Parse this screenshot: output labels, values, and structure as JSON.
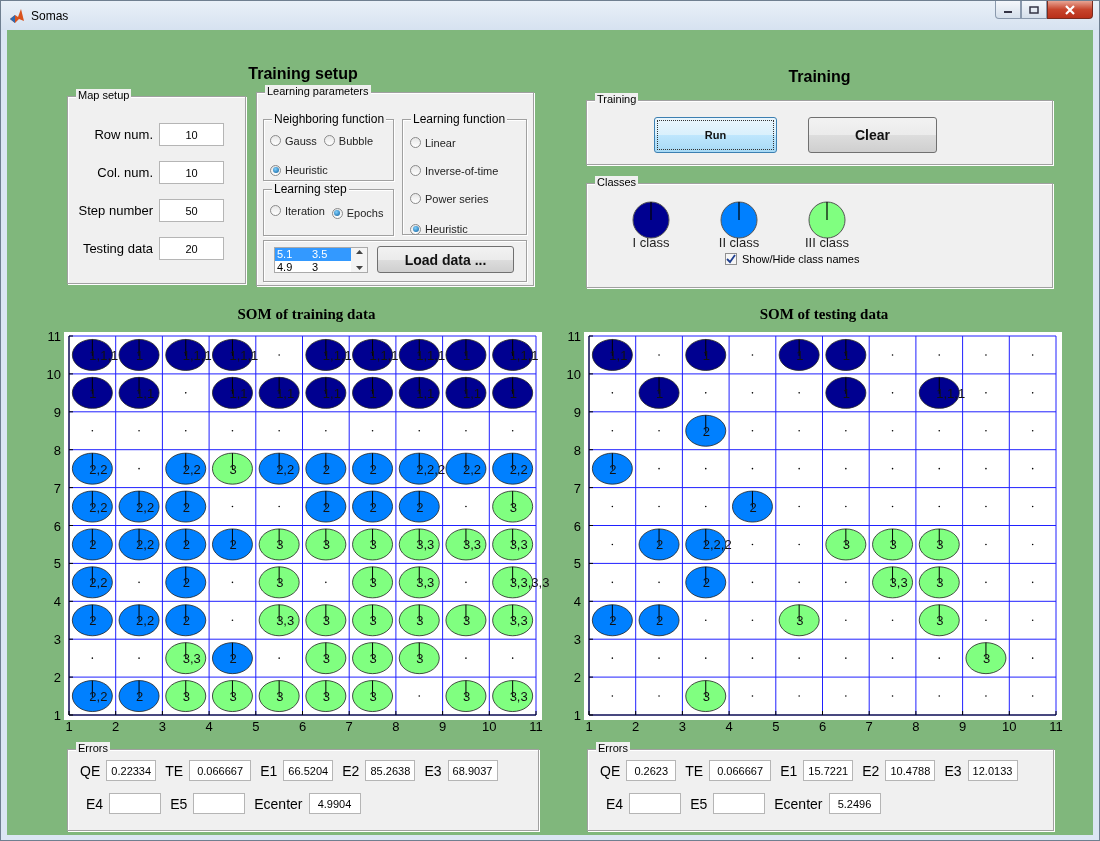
{
  "window": {
    "title": "Somas"
  },
  "training_setup": {
    "heading": "Training setup",
    "map_setup": {
      "title": "Map setup",
      "fields": [
        {
          "label": "Row num.",
          "value": "10"
        },
        {
          "label": "Col. num.",
          "value": "10"
        },
        {
          "label": "Step number",
          "value": "50"
        },
        {
          "label": "Testing data",
          "value": "20"
        }
      ]
    },
    "learning_parameters": {
      "title": "Learning parameters",
      "neighboring_function": {
        "title": "Neighboring function",
        "options": [
          {
            "label": "Gauss",
            "selected": false
          },
          {
            "label": "Bubble",
            "selected": false
          },
          {
            "label": "Heuristic",
            "selected": true
          }
        ]
      },
      "learning_step": {
        "title": "Learning step",
        "options": [
          {
            "label": "Iteration",
            "selected": false
          },
          {
            "label": "Epochs",
            "selected": true
          }
        ]
      },
      "learning_function": {
        "title": "Learning function",
        "options": [
          {
            "label": "Linear",
            "selected": false
          },
          {
            "label": "Inverse-of-time",
            "selected": false
          },
          {
            "label": "Power series",
            "selected": false
          },
          {
            "label": "Heuristic",
            "selected": true
          }
        ]
      },
      "data_list": {
        "rows": [
          {
            "col_1": "5.1",
            "col_2": "3.5",
            "selected": true
          },
          {
            "col_1": "4.9",
            "col_2": "3",
            "selected": false
          }
        ]
      },
      "load_button": "Load data ..."
    }
  },
  "training": {
    "heading": "Training",
    "panel_title": "Training",
    "buttons": [
      {
        "label": "Run",
        "focused": true
      },
      {
        "label": "Clear",
        "focused": false
      }
    ]
  },
  "classes": {
    "title": "Classes",
    "items": [
      {
        "name": "I class",
        "color": "#000090"
      },
      {
        "name": "II class",
        "color": "#0080ff"
      },
      {
        "name": "III class",
        "color": "#80ff80"
      }
    ],
    "show_names": {
      "label": "Show/Hide class names",
      "checked": true
    }
  },
  "maps": [
    {
      "title": "SOM of training data",
      "x_ticks": [
        "1",
        "2",
        "3",
        "4",
        "5",
        "6",
        "7",
        "8",
        "9",
        "10",
        "11"
      ],
      "y_ticks": [
        "11",
        "10",
        "9",
        "8",
        "7",
        "6",
        "5",
        "4",
        "3",
        "2",
        "1"
      ],
      "rows": [
        {
          "cells": [
            {
              "kind": "node",
              "label": "1,1,1",
              "color": "#000090"
            },
            {
              "kind": "node",
              "label": "1",
              "color": "#000090"
            },
            {
              "kind": "node",
              "label": "1,1,1",
              "color": "#000090"
            },
            {
              "kind": "node",
              "label": "1,1,1",
              "color": "#000090"
            },
            {
              "kind": "empty"
            },
            {
              "kind": "node",
              "label": "1,1,1",
              "color": "#000090"
            },
            {
              "kind": "node",
              "label": "1,1,1",
              "color": "#000090"
            },
            {
              "kind": "node",
              "label": "1,1,1",
              "color": "#000090"
            },
            {
              "kind": "node",
              "label": "1",
              "color": "#000090"
            },
            {
              "kind": "node",
              "label": "1,1,1",
              "color": "#000090"
            }
          ]
        },
        {
          "cells": [
            {
              "kind": "node",
              "label": "1",
              "color": "#000090"
            },
            {
              "kind": "node",
              "label": "1,1",
              "color": "#000090"
            },
            {
              "kind": "empty"
            },
            {
              "kind": "node",
              "label": "1,1",
              "color": "#000090"
            },
            {
              "kind": "node",
              "label": "1,1",
              "color": "#000090"
            },
            {
              "kind": "node",
              "label": "1,1",
              "color": "#000090"
            },
            {
              "kind": "node",
              "label": "1",
              "color": "#000090"
            },
            {
              "kind": "node",
              "label": "1,1",
              "color": "#000090"
            },
            {
              "kind": "node",
              "label": "1,1",
              "color": "#000090"
            },
            {
              "kind": "node",
              "label": "1",
              "color": "#000090"
            }
          ]
        },
        {
          "cells": [
            {
              "kind": "empty"
            },
            {
              "kind": "empty"
            },
            {
              "kind": "empty"
            },
            {
              "kind": "empty"
            },
            {
              "kind": "empty"
            },
            {
              "kind": "empty"
            },
            {
              "kind": "empty"
            },
            {
              "kind": "empty"
            },
            {
              "kind": "empty"
            },
            {
              "kind": "empty"
            }
          ]
        },
        {
          "cells": [
            {
              "kind": "node",
              "label": "2,2",
              "color": "#0080ff"
            },
            {
              "kind": "empty"
            },
            {
              "kind": "node",
              "label": "2,2",
              "color": "#0080ff"
            },
            {
              "kind": "node",
              "label": "3",
              "color": "#80ff80"
            },
            {
              "kind": "node",
              "label": "2,2",
              "color": "#0080ff"
            },
            {
              "kind": "node",
              "label": "2",
              "color": "#0080ff"
            },
            {
              "kind": "node",
              "label": "2",
              "color": "#0080ff"
            },
            {
              "kind": "node",
              "label": "2,2,2",
              "color": "#0080ff"
            },
            {
              "kind": "node",
              "label": "2,2",
              "color": "#0080ff"
            },
            {
              "kind": "node",
              "label": "2,2",
              "color": "#0080ff"
            }
          ]
        },
        {
          "cells": [
            {
              "kind": "node",
              "label": "2,2",
              "color": "#0080ff"
            },
            {
              "kind": "node",
              "label": "2,2",
              "color": "#0080ff"
            },
            {
              "kind": "node",
              "label": "2",
              "color": "#0080ff"
            },
            {
              "kind": "empty"
            },
            {
              "kind": "empty"
            },
            {
              "kind": "node",
              "label": "2",
              "color": "#0080ff"
            },
            {
              "kind": "node",
              "label": "2",
              "color": "#0080ff"
            },
            {
              "kind": "node",
              "label": "2",
              "color": "#0080ff"
            },
            {
              "kind": "empty"
            },
            {
              "kind": "node",
              "label": "3",
              "color": "#80ff80"
            }
          ]
        },
        {
          "cells": [
            {
              "kind": "node",
              "label": "2",
              "color": "#0080ff"
            },
            {
              "kind": "node",
              "label": "2,2",
              "color": "#0080ff"
            },
            {
              "kind": "node",
              "label": "2",
              "color": "#0080ff"
            },
            {
              "kind": "node",
              "label": "2",
              "color": "#0080ff"
            },
            {
              "kind": "node",
              "label": "3",
              "color": "#80ff80"
            },
            {
              "kind": "node",
              "label": "3",
              "color": "#80ff80"
            },
            {
              "kind": "node",
              "label": "3",
              "color": "#80ff80"
            },
            {
              "kind": "node",
              "label": "3,3",
              "color": "#80ff80"
            },
            {
              "kind": "node",
              "label": "3,3",
              "color": "#80ff80"
            },
            {
              "kind": "node",
              "label": "3,3",
              "color": "#80ff80"
            }
          ]
        },
        {
          "cells": [
            {
              "kind": "node",
              "label": "2,2",
              "color": "#0080ff"
            },
            {
              "kind": "empty"
            },
            {
              "kind": "node",
              "label": "2",
              "color": "#0080ff"
            },
            {
              "kind": "empty"
            },
            {
              "kind": "node",
              "label": "3",
              "color": "#80ff80"
            },
            {
              "kind": "empty"
            },
            {
              "kind": "node",
              "label": "3",
              "color": "#80ff80"
            },
            {
              "kind": "node",
              "label": "3,3",
              "color": "#80ff80"
            },
            {
              "kind": "empty"
            },
            {
              "kind": "node",
              "label": "3,3,3,3",
              "color": "#80ff80"
            }
          ]
        },
        {
          "cells": [
            {
              "kind": "node",
              "label": "2",
              "color": "#0080ff"
            },
            {
              "kind": "node",
              "label": "2,2",
              "color": "#0080ff"
            },
            {
              "kind": "node",
              "label": "2",
              "color": "#0080ff"
            },
            {
              "kind": "empty"
            },
            {
              "kind": "node",
              "label": "3,3",
              "color": "#80ff80"
            },
            {
              "kind": "node",
              "label": "3",
              "color": "#80ff80"
            },
            {
              "kind": "node",
              "label": "3",
              "color": "#80ff80"
            },
            {
              "kind": "node",
              "label": "3",
              "color": "#80ff80"
            },
            {
              "kind": "node",
              "label": "3",
              "color": "#80ff80"
            },
            {
              "kind": "node",
              "label": "3,3",
              "color": "#80ff80"
            }
          ]
        },
        {
          "cells": [
            {
              "kind": "empty"
            },
            {
              "kind": "empty"
            },
            {
              "kind": "node",
              "label": "3,3",
              "color": "#80ff80"
            },
            {
              "kind": "node",
              "label": "2",
              "color": "#0080ff"
            },
            {
              "kind": "empty"
            },
            {
              "kind": "node",
              "label": "3",
              "color": "#80ff80"
            },
            {
              "kind": "node",
              "label": "3",
              "color": "#80ff80"
            },
            {
              "kind": "node",
              "label": "3",
              "color": "#80ff80"
            },
            {
              "kind": "empty"
            },
            {
              "kind": "empty"
            }
          ]
        },
        {
          "cells": [
            {
              "kind": "node",
              "label": "2,2",
              "color": "#0080ff"
            },
            {
              "kind": "node",
              "label": "2",
              "color": "#0080ff"
            },
            {
              "kind": "node",
              "label": "3",
              "color": "#80ff80"
            },
            {
              "kind": "node",
              "label": "3",
              "color": "#80ff80"
            },
            {
              "kind": "node",
              "label": "3",
              "color": "#80ff80"
            },
            {
              "kind": "node",
              "label": "3",
              "color": "#80ff80"
            },
            {
              "kind": "node",
              "label": "3",
              "color": "#80ff80"
            },
            {
              "kind": "empty"
            },
            {
              "kind": "node",
              "label": "3",
              "color": "#80ff80"
            },
            {
              "kind": "node",
              "label": "3,3",
              "color": "#80ff80"
            }
          ]
        }
      ],
      "errors": {
        "title": "Errors",
        "lines": [
          {
            "fields": [
              {
                "label": "QE",
                "value": "0.22334"
              },
              {
                "label": "TE",
                "value": "0.066667"
              },
              {
                "label": "E1",
                "value": "66.5204"
              },
              {
                "label": "E2",
                "value": "85.2638"
              },
              {
                "label": "E3",
                "value": "68.9037"
              }
            ]
          },
          {
            "fields": [
              {
                "label": "E4"
              },
              {
                "label": "E5"
              },
              {
                "label": "Ecenter",
                "value": "4.9904"
              }
            ]
          }
        ]
      }
    },
    {
      "title": "SOM of testing data",
      "x_ticks": [
        "1",
        "2",
        "3",
        "4",
        "5",
        "6",
        "7",
        "8",
        "9",
        "10",
        "11"
      ],
      "y_ticks": [
        "11",
        "10",
        "9",
        "8",
        "7",
        "6",
        "5",
        "4",
        "3",
        "2",
        "1"
      ],
      "rows": [
        {
          "cells": [
            {
              "kind": "node",
              "label": "1,1",
              "color": "#000090"
            },
            {
              "kind": "empty"
            },
            {
              "kind": "node",
              "label": "1",
              "color": "#000090"
            },
            {
              "kind": "empty"
            },
            {
              "kind": "node",
              "label": "1",
              "color": "#000090"
            },
            {
              "kind": "node",
              "label": "1",
              "color": "#000090"
            },
            {
              "kind": "empty"
            },
            {
              "kind": "empty"
            },
            {
              "kind": "empty"
            },
            {
              "kind": "empty"
            }
          ]
        },
        {
          "cells": [
            {
              "kind": "empty"
            },
            {
              "kind": "node",
              "label": "1",
              "color": "#000090"
            },
            {
              "kind": "empty"
            },
            {
              "kind": "empty"
            },
            {
              "kind": "empty"
            },
            {
              "kind": "node",
              "label": "1",
              "color": "#000090"
            },
            {
              "kind": "empty"
            },
            {
              "kind": "node",
              "label": "1,1,1",
              "color": "#000090"
            },
            {
              "kind": "empty"
            },
            {
              "kind": "empty"
            }
          ]
        },
        {
          "cells": [
            {
              "kind": "empty"
            },
            {
              "kind": "empty"
            },
            {
              "kind": "node",
              "label": "2",
              "color": "#0080ff"
            },
            {
              "kind": "empty"
            },
            {
              "kind": "empty"
            },
            {
              "kind": "empty"
            },
            {
              "kind": "empty"
            },
            {
              "kind": "empty"
            },
            {
              "kind": "empty"
            },
            {
              "kind": "empty"
            }
          ]
        },
        {
          "cells": [
            {
              "kind": "node",
              "label": "2",
              "color": "#0080ff"
            },
            {
              "kind": "empty"
            },
            {
              "kind": "empty"
            },
            {
              "kind": "empty"
            },
            {
              "kind": "empty"
            },
            {
              "kind": "empty"
            },
            {
              "kind": "empty"
            },
            {
              "kind": "empty"
            },
            {
              "kind": "empty"
            },
            {
              "kind": "empty"
            }
          ]
        },
        {
          "cells": [
            {
              "kind": "empty"
            },
            {
              "kind": "empty"
            },
            {
              "kind": "empty"
            },
            {
              "kind": "node",
              "label": "2",
              "color": "#0080ff"
            },
            {
              "kind": "empty"
            },
            {
              "kind": "empty"
            },
            {
              "kind": "empty"
            },
            {
              "kind": "empty"
            },
            {
              "kind": "empty"
            },
            {
              "kind": "empty"
            }
          ]
        },
        {
          "cells": [
            {
              "kind": "empty"
            },
            {
              "kind": "node",
              "label": "2",
              "color": "#0080ff"
            },
            {
              "kind": "node",
              "label": "2,2,2",
              "color": "#0080ff"
            },
            {
              "kind": "empty"
            },
            {
              "kind": "empty"
            },
            {
              "kind": "node",
              "label": "3",
              "color": "#80ff80"
            },
            {
              "kind": "node",
              "label": "3",
              "color": "#80ff80"
            },
            {
              "kind": "node",
              "label": "3",
              "color": "#80ff80"
            },
            {
              "kind": "empty"
            },
            {
              "kind": "empty"
            }
          ]
        },
        {
          "cells": [
            {
              "kind": "empty"
            },
            {
              "kind": "empty"
            },
            {
              "kind": "node",
              "label": "2",
              "color": "#0080ff"
            },
            {
              "kind": "empty"
            },
            {
              "kind": "empty"
            },
            {
              "kind": "empty"
            },
            {
              "kind": "node",
              "label": "3,3",
              "color": "#80ff80"
            },
            {
              "kind": "node",
              "label": "3",
              "color": "#80ff80"
            },
            {
              "kind": "empty"
            },
            {
              "kind": "empty"
            }
          ]
        },
        {
          "cells": [
            {
              "kind": "node",
              "label": "2",
              "color": "#0080ff"
            },
            {
              "kind": "node",
              "label": "2",
              "color": "#0080ff"
            },
            {
              "kind": "empty"
            },
            {
              "kind": "empty"
            },
            {
              "kind": "node",
              "label": "3",
              "color": "#80ff80"
            },
            {
              "kind": "empty"
            },
            {
              "kind": "empty"
            },
            {
              "kind": "node",
              "label": "3",
              "color": "#80ff80"
            },
            {
              "kind": "empty"
            },
            {
              "kind": "empty"
            }
          ]
        },
        {
          "cells": [
            {
              "kind": "empty"
            },
            {
              "kind": "empty"
            },
            {
              "kind": "empty"
            },
            {
              "kind": "empty"
            },
            {
              "kind": "empty"
            },
            {
              "kind": "empty"
            },
            {
              "kind": "empty"
            },
            {
              "kind": "empty"
            },
            {
              "kind": "node",
              "label": "3",
              "color": "#80ff80"
            },
            {
              "kind": "empty"
            }
          ]
        },
        {
          "cells": [
            {
              "kind": "empty"
            },
            {
              "kind": "empty"
            },
            {
              "kind": "node",
              "label": "3",
              "color": "#80ff80"
            },
            {
              "kind": "empty"
            },
            {
              "kind": "empty"
            },
            {
              "kind": "empty"
            },
            {
              "kind": "empty"
            },
            {
              "kind": "empty"
            },
            {
              "kind": "empty"
            },
            {
              "kind": "empty"
            }
          ]
        }
      ],
      "errors": {
        "title": "Errors",
        "lines": [
          {
            "fields": [
              {
                "label": "QE",
                "value": "0.2623"
              },
              {
                "label": "TE",
                "value": "0.066667"
              },
              {
                "label": "E1",
                "value": "15.7221"
              },
              {
                "label": "E2",
                "value": "10.4788"
              },
              {
                "label": "E3",
                "value": "12.0133"
              }
            ]
          },
          {
            "fields": [
              {
                "label": "E4"
              },
              {
                "label": "E5"
              },
              {
                "label": "Ecenter",
                "value": "5.2496"
              }
            ]
          }
        ]
      }
    }
  ]
}
